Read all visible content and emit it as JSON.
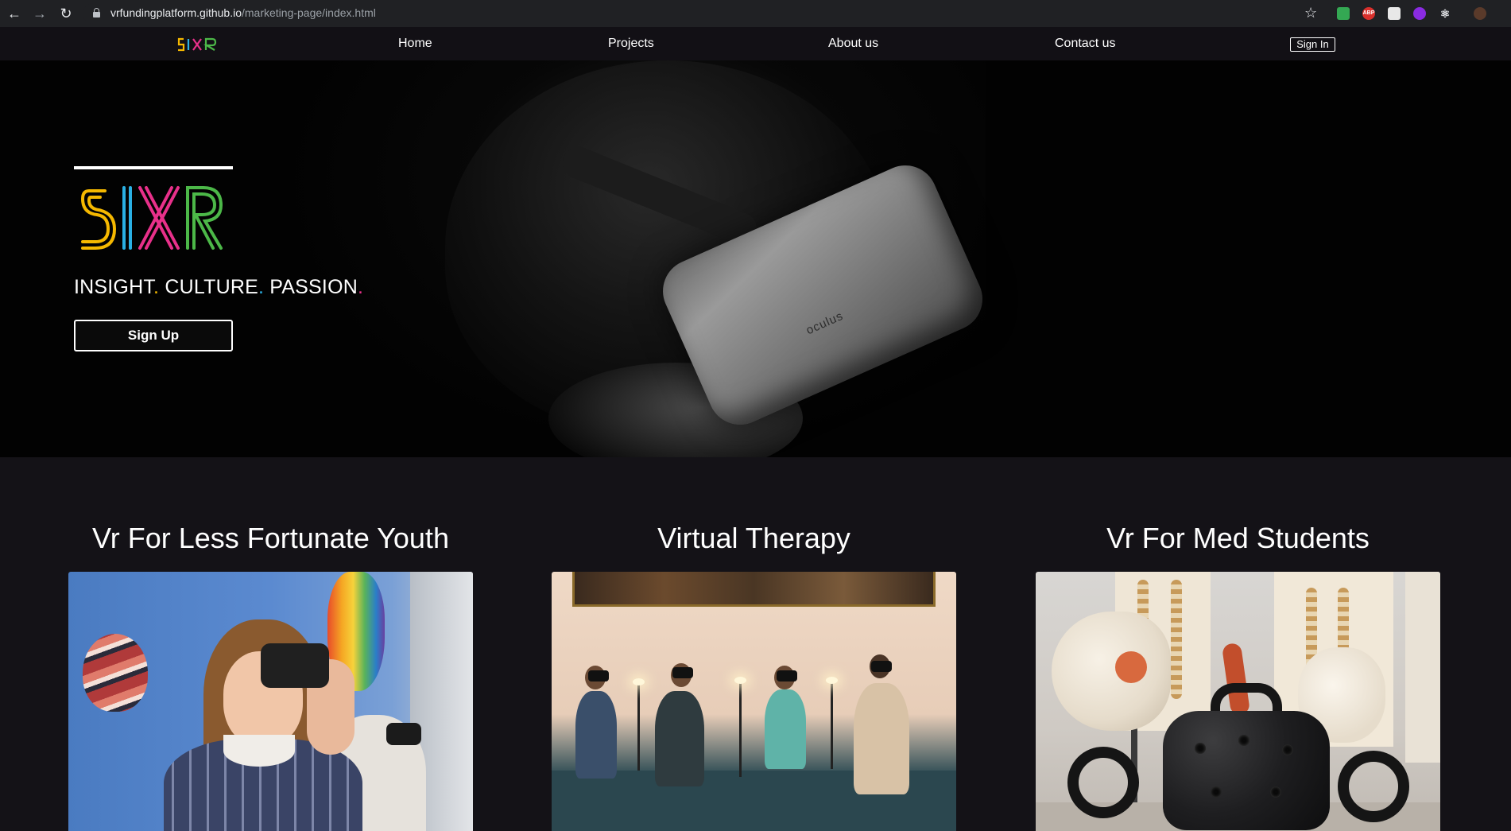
{
  "browser": {
    "url_host": "vrfundingplatform.github.io",
    "url_path": "/marketing-page/index.html",
    "back_icon": "back-arrow-icon",
    "forward_icon": "forward-arrow-icon",
    "reload_icon": "reload-icon",
    "bookmark_icon": "star-icon",
    "extensions": [
      "sheets-extension-icon",
      "adblock-plus-icon",
      "pdf-extension-icon",
      "vpn-extension-icon",
      "react-devtools-icon",
      "profile-avatar-icon"
    ],
    "adblock_label": "ABP"
  },
  "nav": {
    "logo_text": "SIXR",
    "links": [
      "Home",
      "Projects",
      "About us",
      "Contact us"
    ],
    "signin_label": "Sign In"
  },
  "hero": {
    "logo_text": "SIXR",
    "tagline_words": [
      "INSIGHT",
      "CULTURE",
      "PASSION"
    ],
    "tagline_dot": ".",
    "signup_label": "Sign Up",
    "headset_brand": "oculus"
  },
  "projects": [
    {
      "title": "Vr For Less Fortunate Youth"
    },
    {
      "title": "Virtual Therapy"
    },
    {
      "title": "Vr For Med Students"
    }
  ],
  "colors": {
    "page_bg": "#141217",
    "nav_bg": "#121015",
    "logo_yellow": "#f5b800",
    "logo_blue": "#2ab0e4",
    "logo_pink": "#e8308a",
    "logo_green": "#4cb848"
  }
}
